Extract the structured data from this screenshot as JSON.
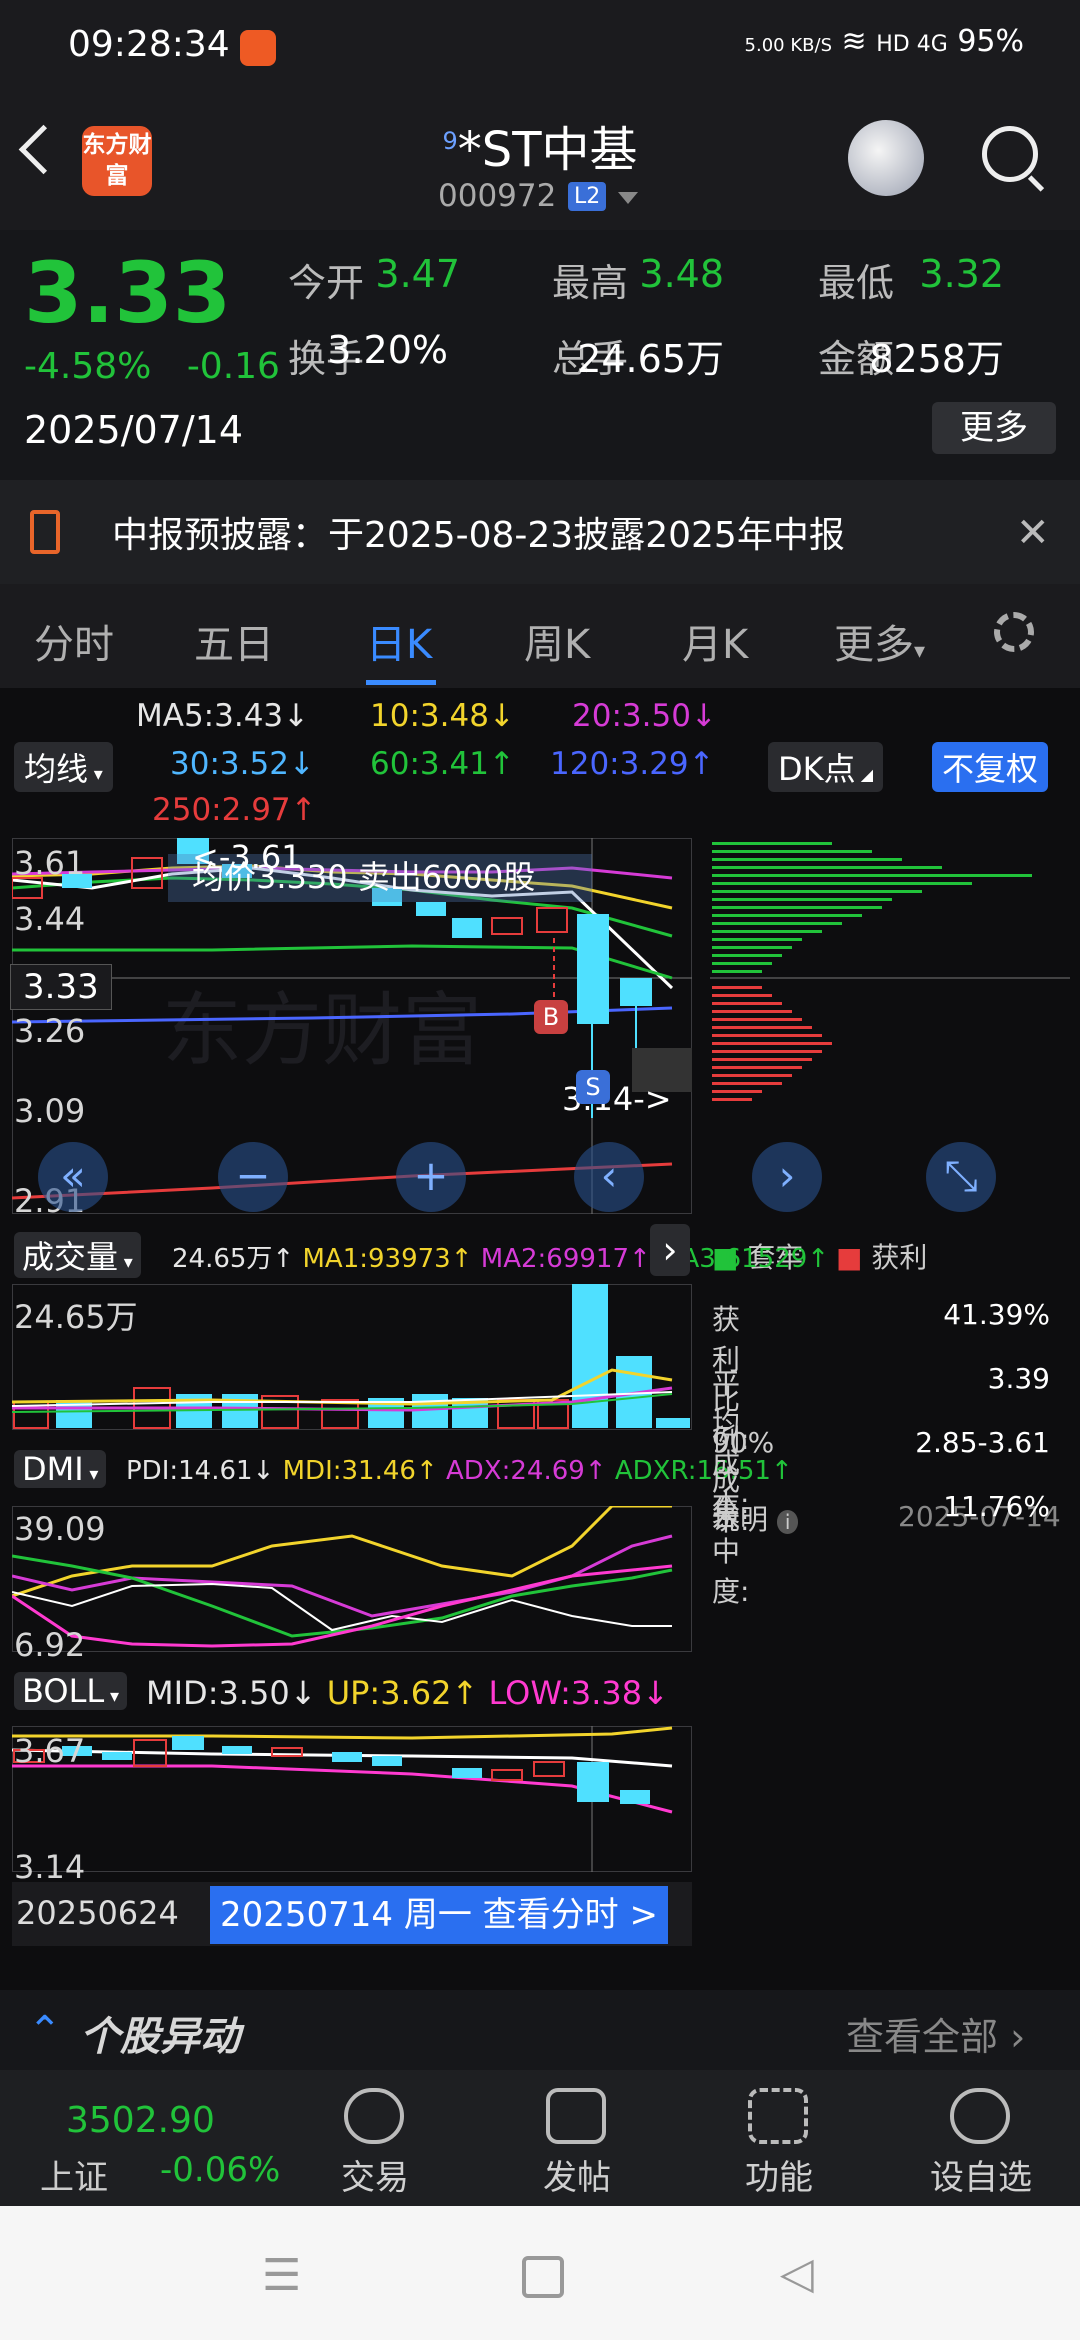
{
  "status_bar": {
    "time": "09:28:34",
    "speed": "5.00 KB/S",
    "network": "HD 4G",
    "battery": "95%"
  },
  "header": {
    "logo_text": "东方财富",
    "badge": "9",
    "stock_name": "*ST中基",
    "stock_code": "000972",
    "level": "L2"
  },
  "quote": {
    "price": "3.33",
    "change_pct": "-4.58%",
    "change": "-0.16",
    "date": "2025/07/14",
    "fields": [
      {
        "label": "今开",
        "value": "3.47",
        "color": "#21c33a"
      },
      {
        "label": "最高",
        "value": "3.48",
        "color": "#21c33a"
      },
      {
        "label": "最低",
        "value": "3.32",
        "color": "#21c33a"
      },
      {
        "label": "换手",
        "value": "3.20%",
        "color": "#ffffff"
      },
      {
        "label": "总手",
        "value": "24.65万",
        "color": "#ffffff"
      },
      {
        "label": "金额",
        "value": "8258万",
        "color": "#ffffff"
      }
    ],
    "more": "更多"
  },
  "notice": {
    "text": "中报预披露：于2025-08-23披露2025年中报"
  },
  "tabs": [
    "分时",
    "五日",
    "日K",
    "周K",
    "月K",
    "更多"
  ],
  "active_tab": "日K",
  "ma": {
    "selector": "均线",
    "items": [
      {
        "text": "MA5:3.43",
        "arrow": "↓",
        "color": "#ffffff"
      },
      {
        "text": "10:3.48",
        "arrow": "↓",
        "color": "#f2d42c"
      },
      {
        "text": "20:3.50",
        "arrow": "↓",
        "color": "#d63bd6"
      },
      {
        "text": "30:3.52",
        "arrow": "↓",
        "color": "#4fb6ff"
      },
      {
        "text": "60:3.41",
        "arrow": "↑",
        "color": "#21c33a"
      },
      {
        "text": "120:3.29",
        "arrow": "↑",
        "color": "#4a66ff"
      },
      {
        "text": "250:2.97",
        "arrow": "↑",
        "color": "#e63c3c"
      }
    ],
    "dk_button": "DK点",
    "adjust_button": "不复权"
  },
  "kline": {
    "y_labels": [
      "3.61",
      "3.44",
      "3.26",
      "3.09",
      "2.91"
    ],
    "current_price_tag": "3.33",
    "annotation_top": "<-3.61",
    "annotation_avg": "均价3.330  卖出6000股",
    "annotation_low": "3.14->",
    "marker_b": "B",
    "marker_s": "S",
    "watermark": "东方财富"
  },
  "chip": {
    "legend": [
      {
        "label": "套牢",
        "color": "#21c33a"
      },
      {
        "label": "获利",
        "color": "#e63c3c"
      }
    ],
    "stats": [
      {
        "label": "获利比例:",
        "value": "41.39%"
      },
      {
        "label": "平均成本:",
        "value": "3.39"
      },
      {
        "label": "90%成本:",
        "value": "2.85-3.61"
      },
      {
        "label": "集中度:",
        "value": "11.76%"
      }
    ],
    "note_label": "说明",
    "note_date": "2025-07-14"
  },
  "volume": {
    "selector": "成交量",
    "items": [
      {
        "text": "24.65万↑",
        "color": "#ffffff"
      },
      {
        "text": "MA1:93973↑",
        "color": "#f2d42c"
      },
      {
        "text": "MA2:69917↑",
        "color": "#d63bd6"
      },
      {
        "text": "MA3:61529↑",
        "color": "#21c33a"
      }
    ],
    "max_label": "24.65万"
  },
  "dmi": {
    "selector": "DMI",
    "items": [
      {
        "text": "PDI:14.61↓",
        "color": "#ffffff"
      },
      {
        "text": "MDI:31.46↑",
        "color": "#f2d42c"
      },
      {
        "text": "ADX:24.69↑",
        "color": "#d63bd6"
      },
      {
        "text": "ADXR:16.51↑",
        "color": "#21c33a"
      }
    ],
    "max_label": "39.09",
    "min_label": "6.92"
  },
  "boll": {
    "selector": "BOLL",
    "items": [
      {
        "text": "MID:3.50↓",
        "color": "#ffffff"
      },
      {
        "text": "UP:3.62↑",
        "color": "#f2d42c"
      },
      {
        "text": "LOW:3.38↓",
        "color": "#ff3ad0"
      }
    ],
    "max_label": "3.67",
    "min_label": "3.14"
  },
  "date_bar": {
    "start": "20250624",
    "current": "20250714 周一 查看分时 >"
  },
  "section": {
    "title": "个股异动",
    "link": "查看全部"
  },
  "bottom_nav": {
    "index_value": "3502.90",
    "index_name": "上证",
    "index_change": "-0.06%",
    "items": [
      "交易",
      "发帖",
      "功能",
      "设自选"
    ]
  }
}
